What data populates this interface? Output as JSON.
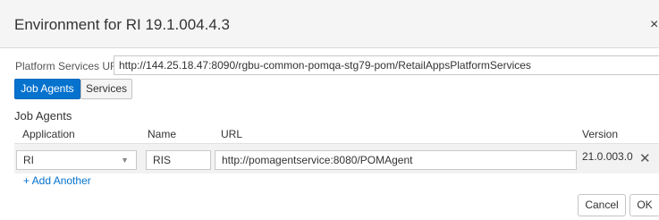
{
  "dialog": {
    "title": "Environment for RI 19.1.004.4.3",
    "close_glyph": "×",
    "close_icon": "close-icon"
  },
  "platform_services": {
    "label": "Platform Services URL",
    "value": "http://144.25.18.47:8090/rgbu-common-pomqa-stg79-pom/RetailAppsPlatformServices"
  },
  "tabs": [
    {
      "label": "Job Agents",
      "active": true
    },
    {
      "label": "Services",
      "active": false
    }
  ],
  "job_agents": {
    "section_title": "Job Agents",
    "columns": [
      "Application",
      "Name",
      "URL",
      "Version"
    ],
    "rows": [
      {
        "application": "RI",
        "name": "RIS",
        "url": "http://pomagentservice:8080/POMAgent",
        "version": "21.0.003.0",
        "remove_glyph": "✕"
      }
    ],
    "dropdown_icon": "chevron-down-icon",
    "add_another_label": "+ Add Another"
  },
  "footer": {
    "cancel_label": "Cancel",
    "ok_label": "OK"
  },
  "colors": {
    "accent": "#0572ce",
    "header_bg": "#f5f5f5",
    "row_bg": "#f2f2f2"
  }
}
